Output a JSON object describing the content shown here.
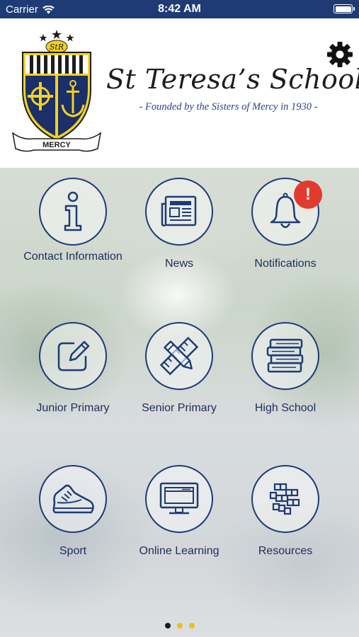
{
  "status_bar": {
    "carrier": "Carrier",
    "time": "8:42 AM"
  },
  "header": {
    "school_name": "St Teresa’s School",
    "tagline": "- Founded by the Sisters of Mercy in 1930 -",
    "crest_monogram": "StR",
    "crest_banner": "MERCY"
  },
  "tiles": [
    {
      "label": "Contact Information",
      "icon": "info-icon"
    },
    {
      "label": "News",
      "icon": "newspaper-icon"
    },
    {
      "label": "Notifications",
      "icon": "bell-icon",
      "badge": "!"
    },
    {
      "label": "Junior Primary",
      "icon": "pencil-note-icon"
    },
    {
      "label": "Senior Primary",
      "icon": "ruler-pencil-icon"
    },
    {
      "label": "High School",
      "icon": "books-icon"
    },
    {
      "label": "Sport",
      "icon": "sneaker-icon"
    },
    {
      "label": "Online Learning",
      "icon": "monitor-icon"
    },
    {
      "label": "Resources",
      "icon": "grid-pattern-icon"
    }
  ],
  "pager": {
    "page_count": 3,
    "active_index": 0,
    "active_color": "#1a1a1a",
    "inactive_color": "#e8c21a"
  },
  "colors": {
    "brand_navy": "#1f3b75",
    "badge_red": "#e23b2e",
    "crest_yellow": "#f4d21e"
  }
}
